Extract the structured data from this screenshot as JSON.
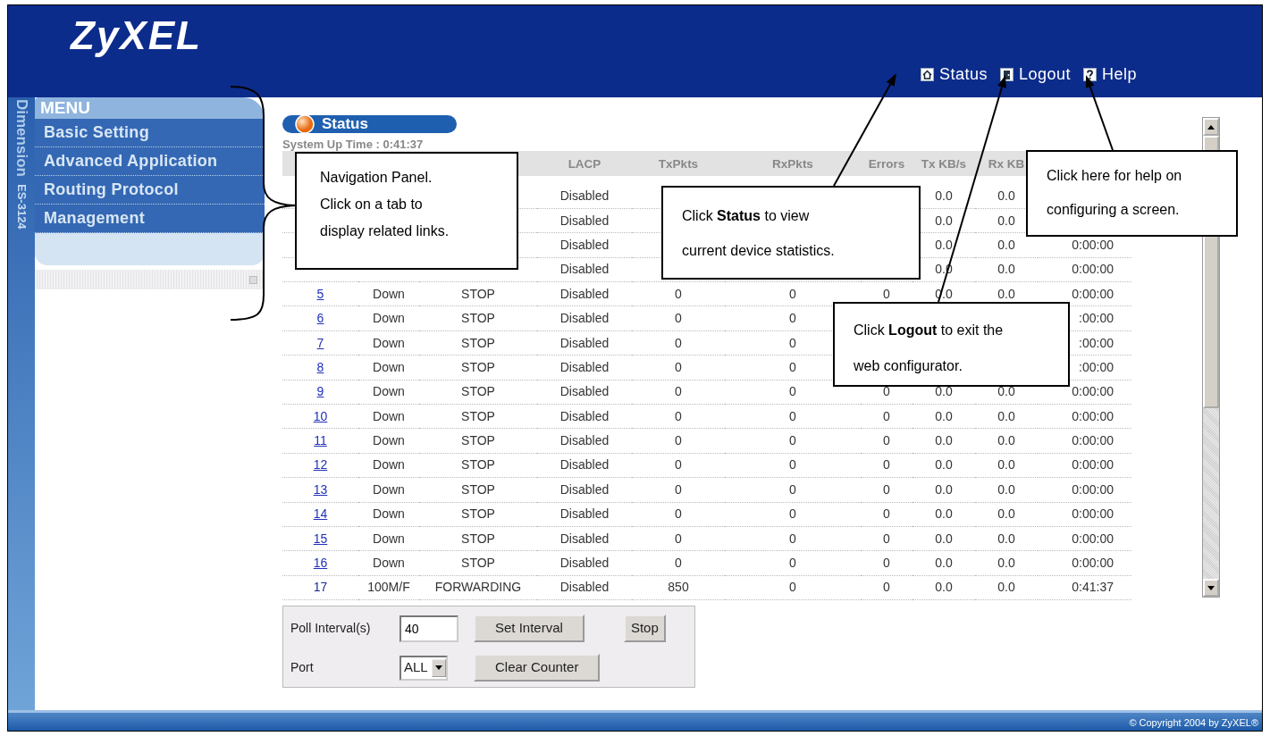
{
  "brand": {
    "logo": "ZyXEL",
    "model_strip": [
      "Dimension",
      "ES-3124"
    ]
  },
  "header_links": [
    {
      "label": "Status",
      "kind": "home"
    },
    {
      "label": "Logout",
      "kind": "logout"
    },
    {
      "label": "Help",
      "kind": "help"
    }
  ],
  "menu": {
    "title": "MENU",
    "items": [
      "Basic Setting",
      "Advanced Application",
      "Routing Protocol",
      "Management"
    ]
  },
  "page": {
    "title": "Status",
    "uptime": "System Up Time : 0:41:37"
  },
  "table": {
    "columns": [
      null,
      null,
      null,
      "LACP",
      "TxPkts",
      "RxPkts",
      "Errors",
      "Tx KB/s",
      "Rx KB",
      null
    ],
    "rows": [
      {
        "cells": [
          null,
          null,
          null,
          "Disabled",
          null,
          null,
          null,
          "0.0",
          "0.0",
          null
        ]
      },
      {
        "cells": [
          null,
          null,
          null,
          "Disabled",
          null,
          null,
          null,
          "0.0",
          "0.0",
          null
        ]
      },
      {
        "cells": [
          null,
          null,
          null,
          "Disabled",
          null,
          null,
          null,
          "0.0",
          "0.0",
          "0:00:00"
        ]
      },
      {
        "cells": [
          null,
          null,
          null,
          "Disabled",
          null,
          null,
          null,
          "0.0",
          "0.0",
          "0:00:00"
        ]
      },
      {
        "port_link": true,
        "cells": [
          "5",
          "Down",
          "STOP",
          "Disabled",
          "0",
          "0",
          "0",
          "0.0",
          "0.0",
          "0:00:00"
        ]
      },
      {
        "port_link": true,
        "cells": [
          "6",
          "Down",
          "STOP",
          "Disabled",
          "0",
          "0",
          null,
          null,
          null,
          ":00:00"
        ]
      },
      {
        "port_link": true,
        "cells": [
          "7",
          "Down",
          "STOP",
          "Disabled",
          "0",
          "0",
          null,
          null,
          null,
          ":00:00"
        ]
      },
      {
        "port_link": true,
        "cells": [
          "8",
          "Down",
          "STOP",
          "Disabled",
          "0",
          "0",
          null,
          null,
          null,
          ":00:00"
        ]
      },
      {
        "port_link": true,
        "cells": [
          "9",
          "Down",
          "STOP",
          "Disabled",
          "0",
          "0",
          "0",
          "0.0",
          "0.0",
          "0:00:00"
        ]
      },
      {
        "port_link": true,
        "cells": [
          "10",
          "Down",
          "STOP",
          "Disabled",
          "0",
          "0",
          "0",
          "0.0",
          "0.0",
          "0:00:00"
        ]
      },
      {
        "port_link": true,
        "cells": [
          "11",
          "Down",
          "STOP",
          "Disabled",
          "0",
          "0",
          "0",
          "0.0",
          "0.0",
          "0:00:00"
        ]
      },
      {
        "port_link": true,
        "cells": [
          "12",
          "Down",
          "STOP",
          "Disabled",
          "0",
          "0",
          "0",
          "0.0",
          "0.0",
          "0:00:00"
        ]
      },
      {
        "port_link": true,
        "cells": [
          "13",
          "Down",
          "STOP",
          "Disabled",
          "0",
          "0",
          "0",
          "0.0",
          "0.0",
          "0:00:00"
        ]
      },
      {
        "port_link": true,
        "cells": [
          "14",
          "Down",
          "STOP",
          "Disabled",
          "0",
          "0",
          "0",
          "0.0",
          "0.0",
          "0:00:00"
        ]
      },
      {
        "port_link": true,
        "cells": [
          "15",
          "Down",
          "STOP",
          "Disabled",
          "0",
          "0",
          "0",
          "0.0",
          "0.0",
          "0:00:00"
        ]
      },
      {
        "port_link": true,
        "cells": [
          "16",
          "Down",
          "STOP",
          "Disabled",
          "0",
          "0",
          "0",
          "0.0",
          "0.0",
          "0:00:00"
        ]
      },
      {
        "port_link": false,
        "cells": [
          "17",
          "100M/F",
          "FORWARDING",
          "Disabled",
          "850",
          "0",
          "0",
          "0.0",
          "0.0",
          "0:41:37"
        ]
      }
    ]
  },
  "controls": {
    "poll_label": "Poll Interval(s)",
    "poll_value": "40",
    "set_button": "Set Interval",
    "stop_button": "Stop",
    "port_label": "Port",
    "port_value": "ALL",
    "clear_button": "Clear Counter"
  },
  "footer": "© Copyright 2004 by ZyXEL®",
  "callouts": [
    {
      "kind": "brace",
      "text": "Navigation Panel.\nClick on a tab to\ndisplay related links."
    },
    {
      "kind": "arrow",
      "text": "Click **Status** to view\ncurrent device statistics."
    },
    {
      "kind": "arrow",
      "text": "Click **Logout**  to exit the\nweb configurator."
    },
    {
      "kind": "arrow",
      "text": "Click here for help on\nconfiguring a screen."
    }
  ]
}
